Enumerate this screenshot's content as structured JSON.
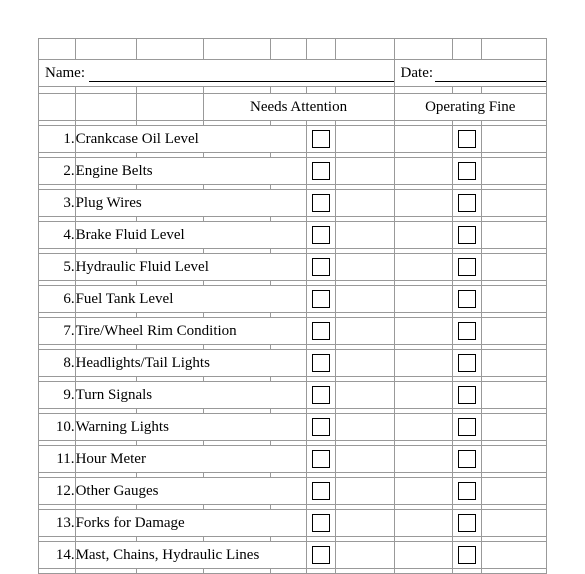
{
  "form": {
    "name_label": "Name:",
    "date_label": "Date:"
  },
  "headers": {
    "needs_attention": "Needs Attention",
    "operating_fine": "Operating Fine"
  },
  "items": [
    {
      "num": "1.",
      "label": "Crankcase Oil Level"
    },
    {
      "num": "2.",
      "label": "Engine Belts"
    },
    {
      "num": "3.",
      "label": "Plug Wires"
    },
    {
      "num": "4.",
      "label": "Brake Fluid Level"
    },
    {
      "num": "5.",
      "label": "Hydraulic Fluid Level"
    },
    {
      "num": "6.",
      "label": "Fuel Tank Level"
    },
    {
      "num": "7.",
      "label": "Tire/Wheel Rim Condition"
    },
    {
      "num": "8.",
      "label": "Headlights/Tail Lights"
    },
    {
      "num": "9.",
      "label": "Turn Signals"
    },
    {
      "num": "10.",
      "label": "Warning Lights"
    },
    {
      "num": "11.",
      "label": "Hour Meter"
    },
    {
      "num": "12.",
      "label": "Other Gauges"
    },
    {
      "num": "13.",
      "label": "Forks for Damage"
    },
    {
      "num": "14.",
      "label": "Mast, Chains, Hydraulic Lines"
    }
  ]
}
